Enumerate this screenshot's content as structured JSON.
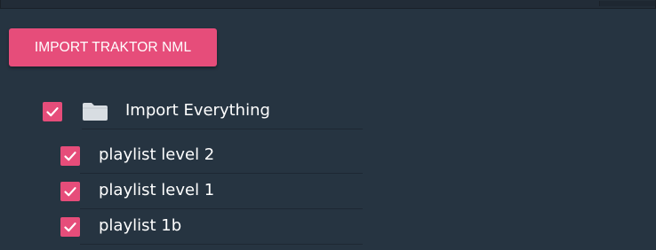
{
  "toolbar": {
    "import_label": "IMPORT TRAKTOR NML"
  },
  "tree": {
    "root": {
      "label": "Import Everything",
      "checked": true,
      "icon": "folder-icon"
    },
    "children": [
      {
        "label": "playlist level 2",
        "checked": true
      },
      {
        "label": "playlist level 1",
        "checked": true
      },
      {
        "label": "playlist 1b",
        "checked": true
      }
    ]
  },
  "colors": {
    "background": "#263441",
    "accent": "#e64d7a",
    "text": "#ffffff",
    "folder": "#d8dde2"
  }
}
